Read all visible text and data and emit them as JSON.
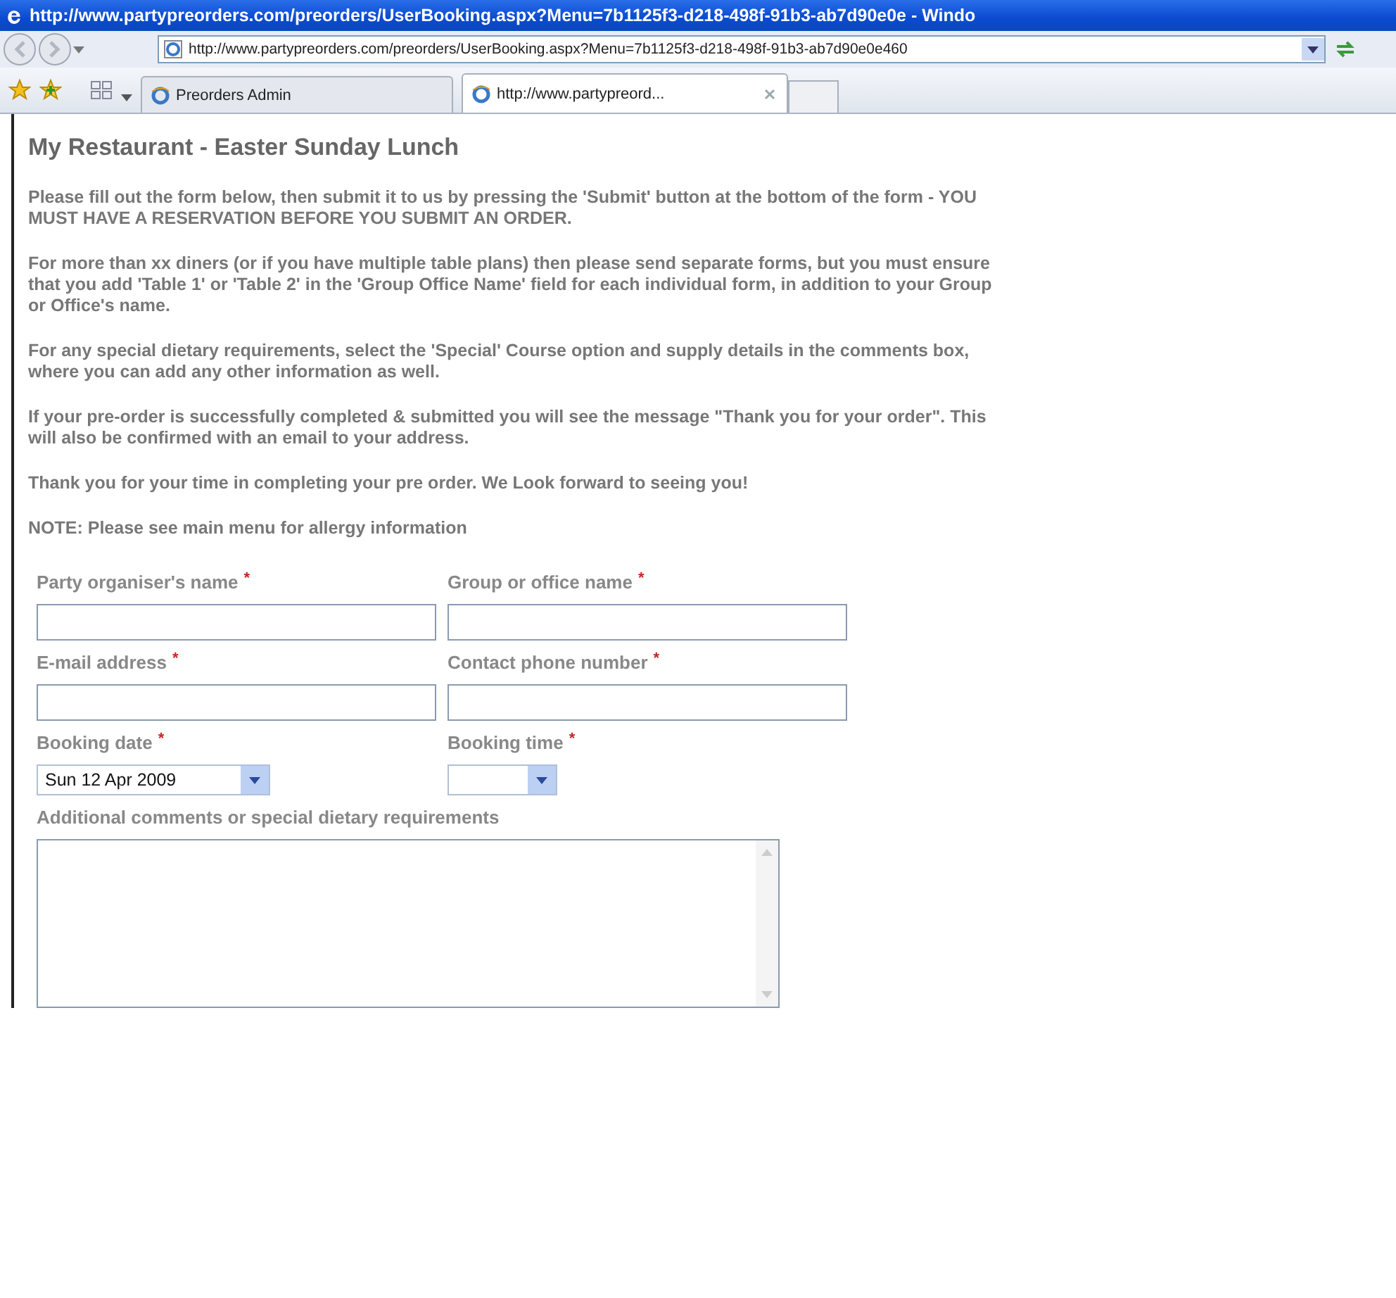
{
  "window": {
    "title": "http://www.partypreorders.com/preorders/UserBooking.aspx?Menu=7b1125f3-d218-498f-91b3-ab7d90e0e - Windo"
  },
  "address_bar": {
    "value": "http://www.partypreorders.com/preorders/UserBooking.aspx?Menu=7b1125f3-d218-498f-91b3-ab7d90e0e460"
  },
  "tabs": [
    {
      "label": "Preorders Admin",
      "selected": false
    },
    {
      "label": "http://www.partypreord...",
      "selected": true
    }
  ],
  "page": {
    "heading": "My Restaurant - Easter Sunday Lunch",
    "paragraphs": [
      "Please fill out the form below, then submit it to us by pressing the 'Submit' button at the bottom of the form - YOU\nMUST HAVE A RESERVATION BEFORE YOU SUBMIT AN ORDER.",
      "For more than xx diners (or if you have multiple table plans) then please send separate forms, but you must ensure\nthat you add 'Table 1' or 'Table 2' in the 'Group Office Name' field for each individual form, in addition to your Group\nor Office's name.",
      "For any special dietary requirements, select the 'Special' Course option and supply details in the comments box,\nwhere you can add any other information as well.",
      "If your pre-order is successfully completed & submitted you will see the message \"Thank you for your order\". This\nwill also be confirmed with an email to your address.",
      "Thank you for your time in completing your pre order. We Look forward to seeing you!",
      "NOTE: Please see main menu for allergy information"
    ]
  },
  "form": {
    "rows": [
      [
        {
          "label": "Party organiser's name",
          "required_mark": "*",
          "kind": "text"
        },
        {
          "label": "Group or office name",
          "required_mark": "*",
          "kind": "text"
        }
      ],
      [
        {
          "label": "E-mail address",
          "required_mark": "*",
          "kind": "text"
        },
        {
          "label": "Contact phone number",
          "required_mark": "*",
          "kind": "text"
        }
      ],
      [
        {
          "label": "Booking date",
          "required_mark": "*",
          "kind": "select",
          "value": "Sun 12 Apr 2009"
        },
        {
          "label": "Booking time",
          "required_mark": "*",
          "kind": "select"
        }
      ]
    ],
    "comments": {
      "label": "Additional comments or special dietary requirements"
    }
  }
}
